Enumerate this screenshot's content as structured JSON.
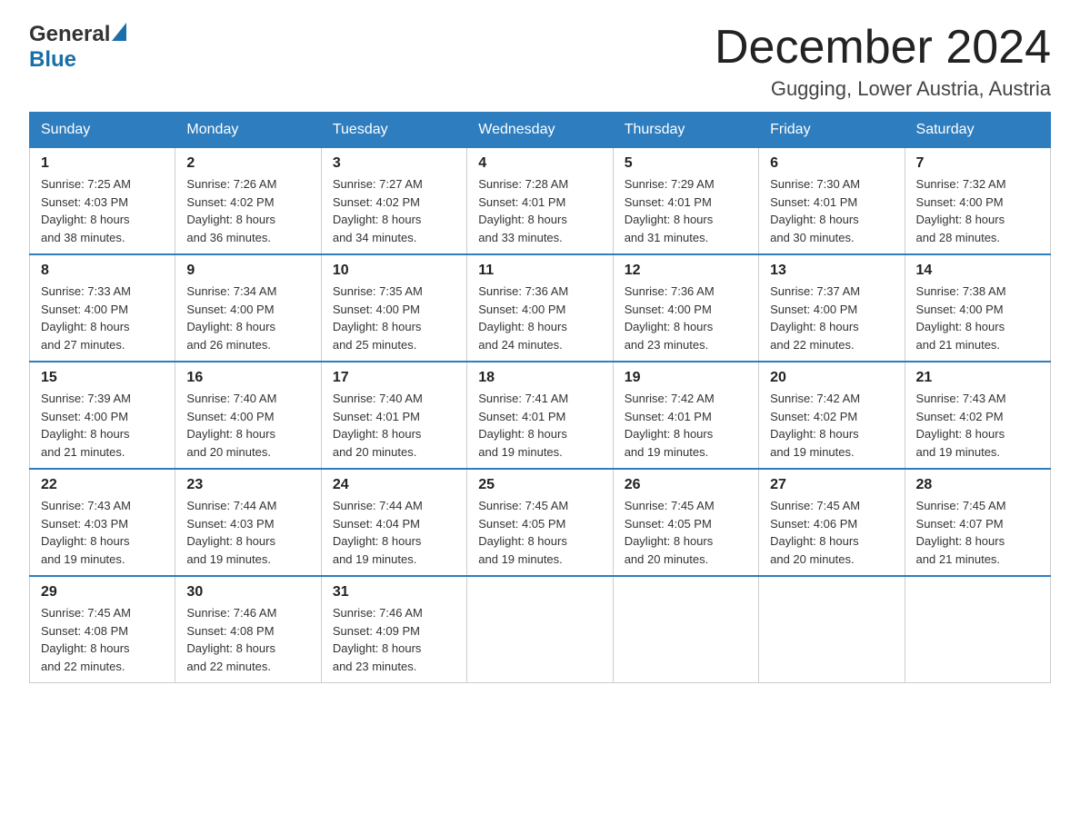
{
  "logo": {
    "general": "General",
    "blue": "Blue"
  },
  "header": {
    "month_year": "December 2024",
    "location": "Gugging, Lower Austria, Austria"
  },
  "days_of_week": [
    "Sunday",
    "Monday",
    "Tuesday",
    "Wednesday",
    "Thursday",
    "Friday",
    "Saturday"
  ],
  "weeks": [
    [
      {
        "day": "1",
        "sunrise": "7:25 AM",
        "sunset": "4:03 PM",
        "daylight": "8 hours and 38 minutes."
      },
      {
        "day": "2",
        "sunrise": "7:26 AM",
        "sunset": "4:02 PM",
        "daylight": "8 hours and 36 minutes."
      },
      {
        "day": "3",
        "sunrise": "7:27 AM",
        "sunset": "4:02 PM",
        "daylight": "8 hours and 34 minutes."
      },
      {
        "day": "4",
        "sunrise": "7:28 AM",
        "sunset": "4:01 PM",
        "daylight": "8 hours and 33 minutes."
      },
      {
        "day": "5",
        "sunrise": "7:29 AM",
        "sunset": "4:01 PM",
        "daylight": "8 hours and 31 minutes."
      },
      {
        "day": "6",
        "sunrise": "7:30 AM",
        "sunset": "4:01 PM",
        "daylight": "8 hours and 30 minutes."
      },
      {
        "day": "7",
        "sunrise": "7:32 AM",
        "sunset": "4:00 PM",
        "daylight": "8 hours and 28 minutes."
      }
    ],
    [
      {
        "day": "8",
        "sunrise": "7:33 AM",
        "sunset": "4:00 PM",
        "daylight": "8 hours and 27 minutes."
      },
      {
        "day": "9",
        "sunrise": "7:34 AM",
        "sunset": "4:00 PM",
        "daylight": "8 hours and 26 minutes."
      },
      {
        "day": "10",
        "sunrise": "7:35 AM",
        "sunset": "4:00 PM",
        "daylight": "8 hours and 25 minutes."
      },
      {
        "day": "11",
        "sunrise": "7:36 AM",
        "sunset": "4:00 PM",
        "daylight": "8 hours and 24 minutes."
      },
      {
        "day": "12",
        "sunrise": "7:36 AM",
        "sunset": "4:00 PM",
        "daylight": "8 hours and 23 minutes."
      },
      {
        "day": "13",
        "sunrise": "7:37 AM",
        "sunset": "4:00 PM",
        "daylight": "8 hours and 22 minutes."
      },
      {
        "day": "14",
        "sunrise": "7:38 AM",
        "sunset": "4:00 PM",
        "daylight": "8 hours and 21 minutes."
      }
    ],
    [
      {
        "day": "15",
        "sunrise": "7:39 AM",
        "sunset": "4:00 PM",
        "daylight": "8 hours and 21 minutes."
      },
      {
        "day": "16",
        "sunrise": "7:40 AM",
        "sunset": "4:00 PM",
        "daylight": "8 hours and 20 minutes."
      },
      {
        "day": "17",
        "sunrise": "7:40 AM",
        "sunset": "4:01 PM",
        "daylight": "8 hours and 20 minutes."
      },
      {
        "day": "18",
        "sunrise": "7:41 AM",
        "sunset": "4:01 PM",
        "daylight": "8 hours and 19 minutes."
      },
      {
        "day": "19",
        "sunrise": "7:42 AM",
        "sunset": "4:01 PM",
        "daylight": "8 hours and 19 minutes."
      },
      {
        "day": "20",
        "sunrise": "7:42 AM",
        "sunset": "4:02 PM",
        "daylight": "8 hours and 19 minutes."
      },
      {
        "day": "21",
        "sunrise": "7:43 AM",
        "sunset": "4:02 PM",
        "daylight": "8 hours and 19 minutes."
      }
    ],
    [
      {
        "day": "22",
        "sunrise": "7:43 AM",
        "sunset": "4:03 PM",
        "daylight": "8 hours and 19 minutes."
      },
      {
        "day": "23",
        "sunrise": "7:44 AM",
        "sunset": "4:03 PM",
        "daylight": "8 hours and 19 minutes."
      },
      {
        "day": "24",
        "sunrise": "7:44 AM",
        "sunset": "4:04 PM",
        "daylight": "8 hours and 19 minutes."
      },
      {
        "day": "25",
        "sunrise": "7:45 AM",
        "sunset": "4:05 PM",
        "daylight": "8 hours and 19 minutes."
      },
      {
        "day": "26",
        "sunrise": "7:45 AM",
        "sunset": "4:05 PM",
        "daylight": "8 hours and 20 minutes."
      },
      {
        "day": "27",
        "sunrise": "7:45 AM",
        "sunset": "4:06 PM",
        "daylight": "8 hours and 20 minutes."
      },
      {
        "day": "28",
        "sunrise": "7:45 AM",
        "sunset": "4:07 PM",
        "daylight": "8 hours and 21 minutes."
      }
    ],
    [
      {
        "day": "29",
        "sunrise": "7:45 AM",
        "sunset": "4:08 PM",
        "daylight": "8 hours and 22 minutes."
      },
      {
        "day": "30",
        "sunrise": "7:46 AM",
        "sunset": "4:08 PM",
        "daylight": "8 hours and 22 minutes."
      },
      {
        "day": "31",
        "sunrise": "7:46 AM",
        "sunset": "4:09 PM",
        "daylight": "8 hours and 23 minutes."
      },
      null,
      null,
      null,
      null
    ]
  ],
  "labels": {
    "sunrise": "Sunrise:",
    "sunset": "Sunset:",
    "daylight": "Daylight:"
  }
}
